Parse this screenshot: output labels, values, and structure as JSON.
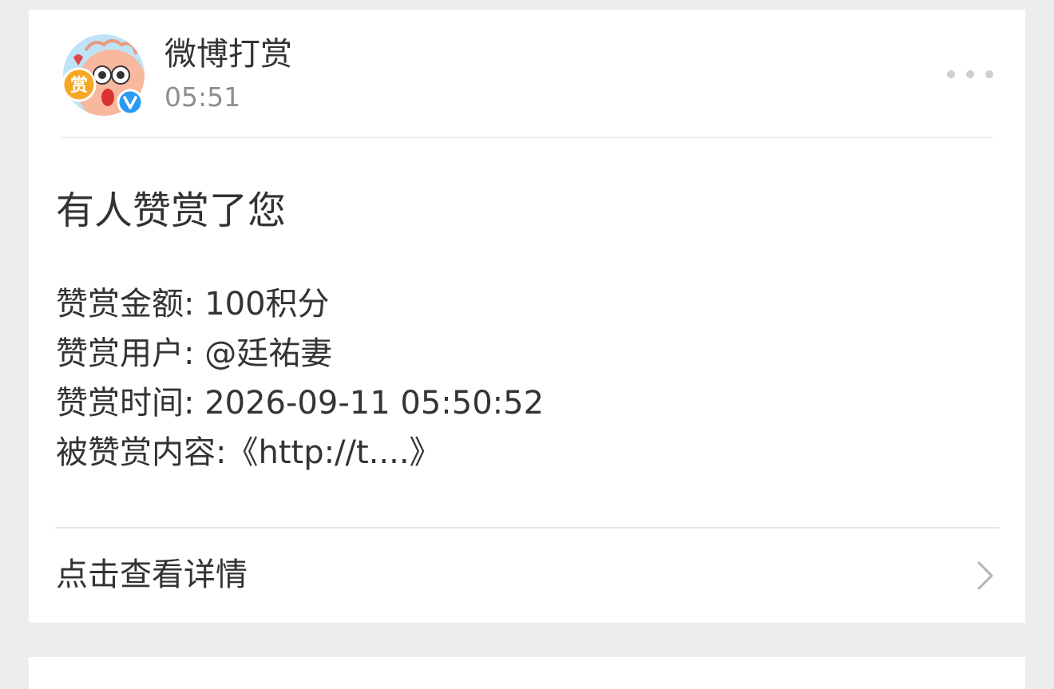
{
  "sender": {
    "name": "微博打赏",
    "time": "05:51",
    "avatar_badge_char": "赏",
    "verified_icon": "verified-badge-icon"
  },
  "header": {
    "more_icon": "more-dots-icon"
  },
  "message": {
    "title": "有人赞赏了您",
    "amount_line": "赞赏金额: 100积分",
    "user_line": "赞赏用户: @廷祐妻",
    "time_line": "赞赏时间: 2026-09-11 05:50:52",
    "content_line": "被赞赏内容:《http://t....》"
  },
  "footer": {
    "view_details_label": "点击查看详情",
    "chevron_icon": "chevron-right-icon"
  },
  "colors": {
    "background": "#ededed",
    "card": "#ffffff",
    "text_primary": "#333333",
    "text_secondary": "#8e8e8e",
    "verified_blue": "#2a9af2",
    "badge_orange": "#f7a823"
  }
}
